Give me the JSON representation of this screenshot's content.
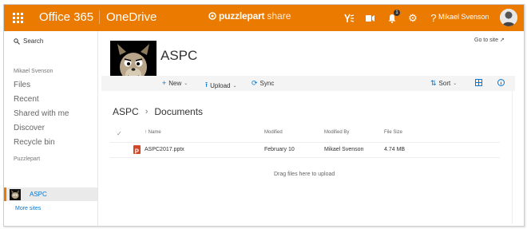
{
  "suite": {
    "brand": "Office 365",
    "app": "OneDrive",
    "logo_bold": "puzzlepart",
    "logo_light": "share",
    "notifications_count": "1",
    "user_name": "Mikael Svenson",
    "accent_color": "#eb7b00"
  },
  "leftnav": {
    "search_label": "Search",
    "owner": "Mikael Svenson",
    "items": [
      "Files",
      "Recent",
      "Shared with me",
      "Discover",
      "Recycle bin"
    ],
    "section": "Puzzlepart",
    "site": "ASPC",
    "more_sites": "More sites"
  },
  "site": {
    "title": "ASPC",
    "goto_site": "Go to site"
  },
  "commands": {
    "new": "New",
    "upload": "Upload",
    "sync": "Sync",
    "sort": "Sort"
  },
  "breadcrumb": [
    "ASPC",
    "Documents"
  ],
  "table": {
    "headers": {
      "name": "Name",
      "modified": "Modified",
      "modified_by": "Modified By",
      "file_size": "File Size"
    },
    "rows": [
      {
        "name": "ASPC2017.pptx",
        "modified": "February 10",
        "modified_by": "Mikael Svenson",
        "size": "4.74 MB"
      }
    ]
  },
  "drag_hint": "Drag files here to upload"
}
